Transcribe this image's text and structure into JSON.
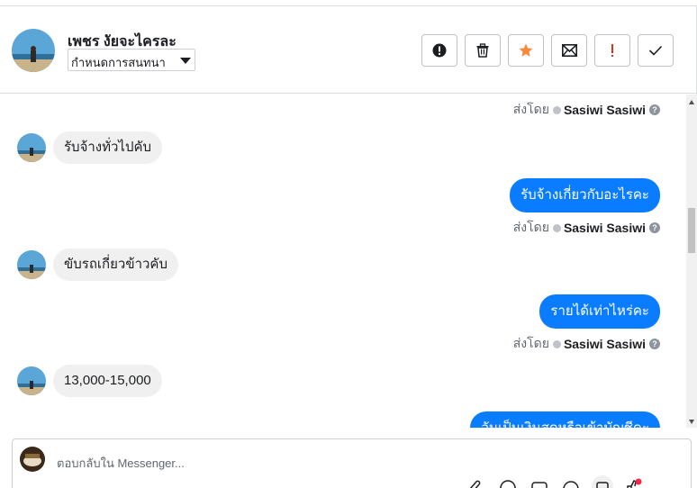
{
  "header": {
    "contact_name": "เพชร งัยจะไครละ",
    "assign_label": "กำหนดการสนทนา",
    "tools": [
      {
        "name": "spam-button",
        "icon": "alert-circle-icon"
      },
      {
        "name": "delete-button",
        "icon": "trash-icon"
      },
      {
        "name": "star-button",
        "icon": "star-icon"
      },
      {
        "name": "mark-unread-button",
        "icon": "envelope-icon"
      },
      {
        "name": "mark-important-button",
        "icon": "exclamation-icon"
      },
      {
        "name": "mark-done-button",
        "icon": "check-icon"
      }
    ]
  },
  "thread": {
    "sent_by_prefix": "ส่งโดย",
    "sender_name": "Sasiwi Sasiwi",
    "help_glyph": "?",
    "messages": [
      {
        "direction": "in",
        "text": "รับจ้างทั่วไปคับ"
      },
      {
        "direction": "out",
        "text": "รับจ้างเกี่ยวกับอะไรคะ"
      },
      {
        "direction": "in",
        "text": "ขับรถเกี่ยวข้าวคับ"
      },
      {
        "direction": "out",
        "text": "รายได้เท่าไหร่คะ"
      },
      {
        "direction": "in",
        "text": "13,000-15,000"
      },
      {
        "direction": "out",
        "text": "วันเป็นเงินสดหรือเข้าบัญชีคะ"
      }
    ]
  },
  "composer": {
    "placeholder": "ตอบกลับใน Messenger..."
  },
  "colors": {
    "outgoing_bubble": "#0a7cff",
    "incoming_bubble": "#f0f0f0",
    "star_accent": "#f5893d",
    "important_accent": "#d93025"
  }
}
